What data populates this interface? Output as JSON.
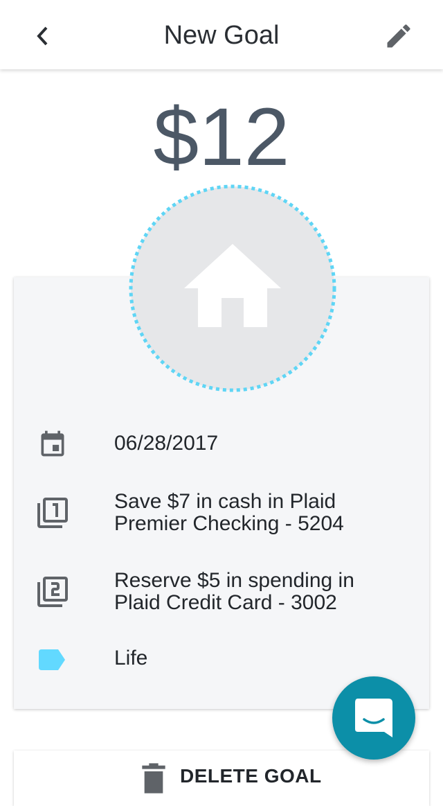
{
  "header": {
    "title": "New Goal",
    "back_icon": "chevron-left-icon",
    "edit_icon": "pencil-icon"
  },
  "goal": {
    "amount": "$12",
    "icon": "house-icon",
    "accent_color": "#5fd5f5"
  },
  "details": {
    "date": "06/28/2017",
    "step1_line1": "Save $7 in cash in Plaid",
    "step1_line2": "Premier Checking - 5204",
    "step2_line1": "Reserve $5 in spending in",
    "step2_line2": "Plaid Credit Card - 3002",
    "category": "Life",
    "category_color": "#62d9ff"
  },
  "actions": {
    "delete_label": "DELETE GOAL",
    "chat_icon": "chat-smile-icon",
    "chat_color": "#0c8fa8"
  }
}
